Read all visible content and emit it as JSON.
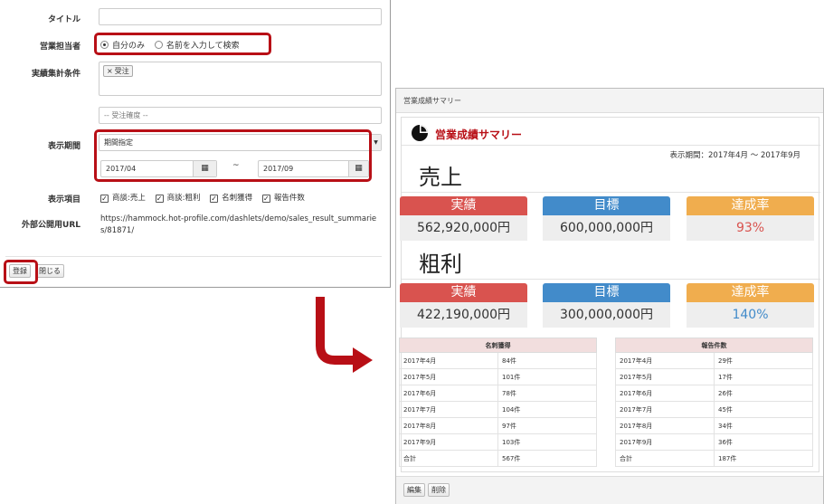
{
  "form": {
    "title_label": "タイトル",
    "title_value": "",
    "sales_owner_label": "営業担当者",
    "radio_self": "自分のみ",
    "radio_name": "名前を入力して検索",
    "conditions_label": "実績集計条件",
    "condition_tag": "受注",
    "condition_tag_remove": "×",
    "order_select_placeholder": "-- 受注確度 --",
    "period_label": "表示期間",
    "period_select": "期間指定",
    "date_from": "2017/04",
    "date_tilde": "~",
    "date_to": "2017/09",
    "items_label": "表示項目",
    "items": [
      "商談:売上",
      "商談:粗利",
      "名刺獲得",
      "報告件数"
    ],
    "url_label": "外部公開用URL",
    "url_value": "https://hammock.hot-profile.com/dashlets/demo/sales_result_summaries/81871/",
    "register_button": "登録",
    "close_button": "閉じる"
  },
  "summary": {
    "panel_header": "営業成績サマリー",
    "title": "営業成績サマリー",
    "period": "表示期間：2017年4月 ～ 2017年9月",
    "sales_title": "売上",
    "profit_title": "粗利",
    "headers": {
      "actual": "実績",
      "target": "目標",
      "rate": "達成率"
    },
    "sales": {
      "actual": "562,920,000円",
      "target": "600,000,000円",
      "rate": "93%"
    },
    "profit": {
      "actual": "422,190,000円",
      "target": "300,000,000円",
      "rate": "140%"
    },
    "colors": {
      "actual": "#d9534f",
      "target": "#428bca",
      "rate": "#f0ad4e",
      "rate_low": "#d9534f",
      "rate_high": "#428bca"
    },
    "cards_table": {
      "header": "名刺獲得",
      "rows": [
        [
          "2017年4月",
          "84件"
        ],
        [
          "2017年5月",
          "101件"
        ],
        [
          "2017年6月",
          "78件"
        ],
        [
          "2017年7月",
          "104件"
        ],
        [
          "2017年8月",
          "97件"
        ],
        [
          "2017年9月",
          "103件"
        ],
        [
          "合計",
          "567件"
        ]
      ]
    },
    "reports_table": {
      "header": "報告件数",
      "rows": [
        [
          "2017年4月",
          "29件"
        ],
        [
          "2017年5月",
          "17件"
        ],
        [
          "2017年6月",
          "26件"
        ],
        [
          "2017年7月",
          "45件"
        ],
        [
          "2017年8月",
          "34件"
        ],
        [
          "2017年9月",
          "36件"
        ],
        [
          "合計",
          "187件"
        ]
      ]
    },
    "edit_button": "編集",
    "delete_button": "削除"
  }
}
